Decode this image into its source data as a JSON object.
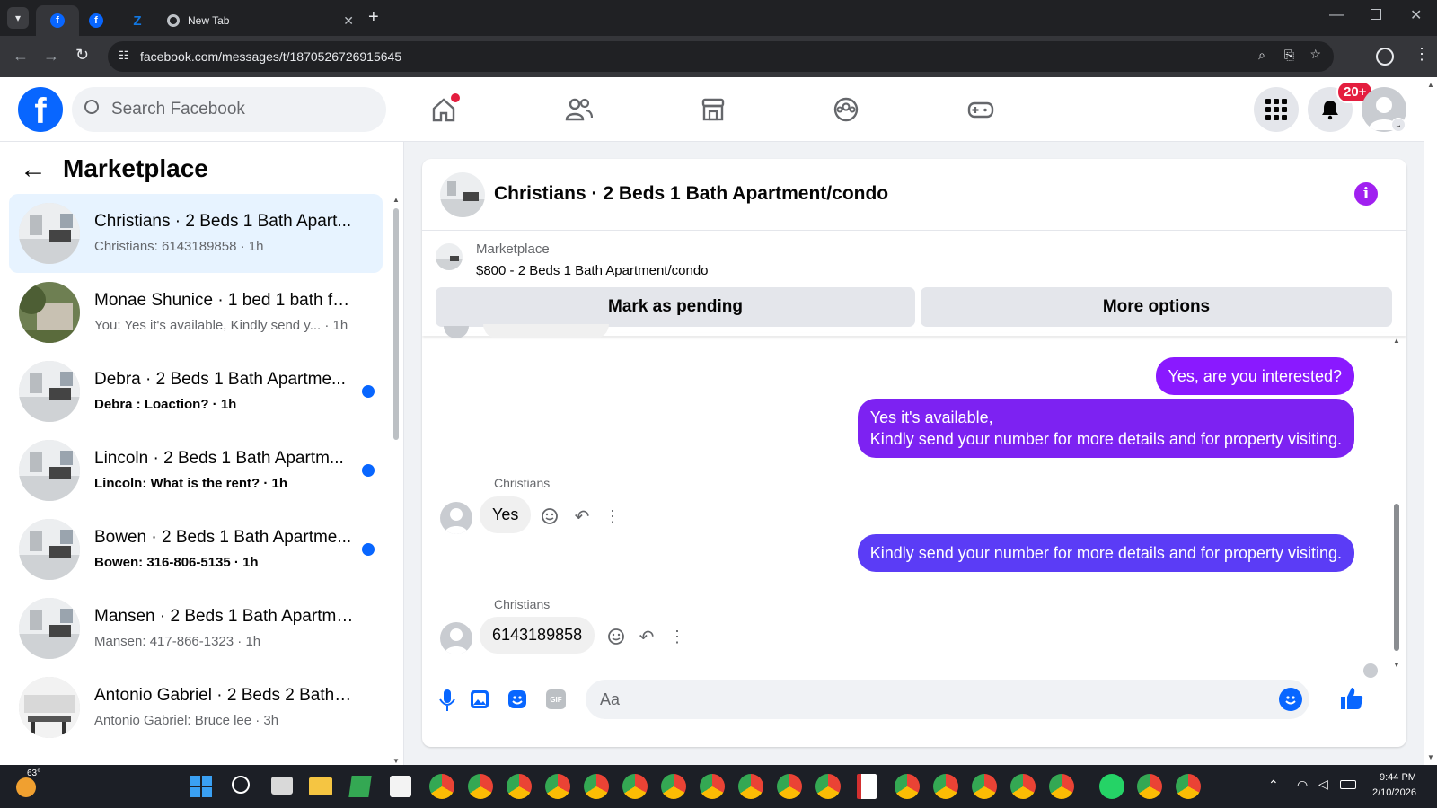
{
  "browser": {
    "tabs": [
      {
        "name": "facebook-tab",
        "title": ""
      },
      {
        "name": "facebook-tab-2",
        "title": ""
      },
      {
        "name": "zillow-tab",
        "title": ""
      },
      {
        "name": "new-tab",
        "title": "New Tab"
      }
    ],
    "url": "facebook.com/messages/t/1870526726915645"
  },
  "fb_nav": {
    "search_placeholder": "Search Facebook",
    "notifications_badge": "20+"
  },
  "sidebar": {
    "title": "Marketplace",
    "conversations": [
      {
        "title": "Christians · 2 Beds 1 Bath Apart...",
        "subtitle": "Christians: 6143189858 · 1h",
        "selected": true,
        "unread": false
      },
      {
        "title": "Monae Shunice · 1 bed 1 bath for...",
        "subtitle": "You: Yes it's available, Kindly send y... · 1h",
        "selected": false,
        "unread": false
      },
      {
        "title": "Debra · 2 Beds 1 Bath Apartme...",
        "subtitle": "Debra : Loaction? · 1h",
        "selected": false,
        "unread": true
      },
      {
        "title": "Lincoln · 2 Beds 1 Bath Apartm...",
        "subtitle": "Lincoln: What is the rent? · 1h",
        "selected": false,
        "unread": true
      },
      {
        "title": "Bowen · 2 Beds 1 Bath Apartme...",
        "subtitle": "Bowen: 316-806-5135 · 1h",
        "selected": false,
        "unread": true
      },
      {
        "title": "Mansen · 2 Beds 1 Bath Apartme...",
        "subtitle": "Mansen: 417-866-1323 · 1h",
        "selected": false,
        "unread": false
      },
      {
        "title": "Antonio Gabriel · 2 Beds 2 Baths ...",
        "subtitle": "Antonio Gabriel: Bruce lee · 3h",
        "selected": false,
        "unread": false
      }
    ]
  },
  "chat": {
    "title": "Christians · 2 Beds 1 Bath Apartment/condo",
    "listing_label": "Marketplace",
    "listing_title": "$800 - 2 Beds 1 Bath Apartment/condo",
    "mark_pending": "Mark as pending",
    "more_options": "More options",
    "messages": [
      {
        "from": "me",
        "text": "Yes, are you interested?"
      },
      {
        "from": "me",
        "text": "Yes it's available,\nKindly send your number for more details and for property visiting."
      },
      {
        "from": "Christians",
        "text": "Yes"
      },
      {
        "from": "me",
        "text": "Kindly send your number for more details and for property visiting."
      },
      {
        "from": "Christians",
        "text": "6143189858"
      }
    ],
    "composer_placeholder": "Aa"
  },
  "taskbar": {
    "weather": "63°",
    "time": "9:44 PM",
    "date": "2/10/2026"
  },
  "colors": {
    "fb_blue": "#0866ff",
    "bubble_purple": "#8a19ff",
    "bubble_blue": "#5b3cf6"
  }
}
